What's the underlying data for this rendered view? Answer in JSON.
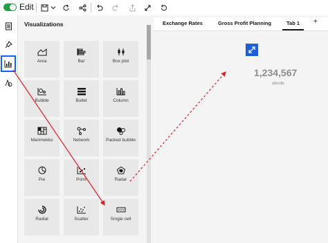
{
  "toolbar": {
    "edit_label": "Edit",
    "buttons": [
      "save-icon",
      "chevron-down-icon",
      "refresh-icon",
      "share-icon",
      "undo-icon",
      "redo-icon",
      "export-icon",
      "fullscreen-icon",
      "reset-icon"
    ]
  },
  "rail": {
    "items": [
      "pages-icon",
      "pin-icon",
      "visualizations-icon",
      "data-icon"
    ]
  },
  "viz_panel": {
    "title": "Visualizations",
    "tiles": [
      {
        "label": "Area"
      },
      {
        "label": "Bar"
      },
      {
        "label": "Box plot"
      },
      {
        "label": "Bubble"
      },
      {
        "label": "Bullet"
      },
      {
        "label": "Column"
      },
      {
        "label": "Marimekko"
      },
      {
        "label": "Network"
      },
      {
        "label": "Packed bubble"
      },
      {
        "label": "Pie"
      },
      {
        "label": "Point"
      },
      {
        "label": "Radar"
      },
      {
        "label": "Radial"
      },
      {
        "label": "Scatter"
      },
      {
        "label": "Single cell"
      }
    ]
  },
  "tabs": [
    {
      "label": "Exchange Rates"
    },
    {
      "label": "Gross Profit Planning"
    },
    {
      "label": "Tab 1"
    }
  ],
  "add_tab": "+",
  "widget": {
    "value": "1,234,567",
    "subtitle": "abcde"
  },
  "colors": {
    "accent": "#0f62fe",
    "arrow": "#da1e28",
    "toggle": "#24a148"
  }
}
